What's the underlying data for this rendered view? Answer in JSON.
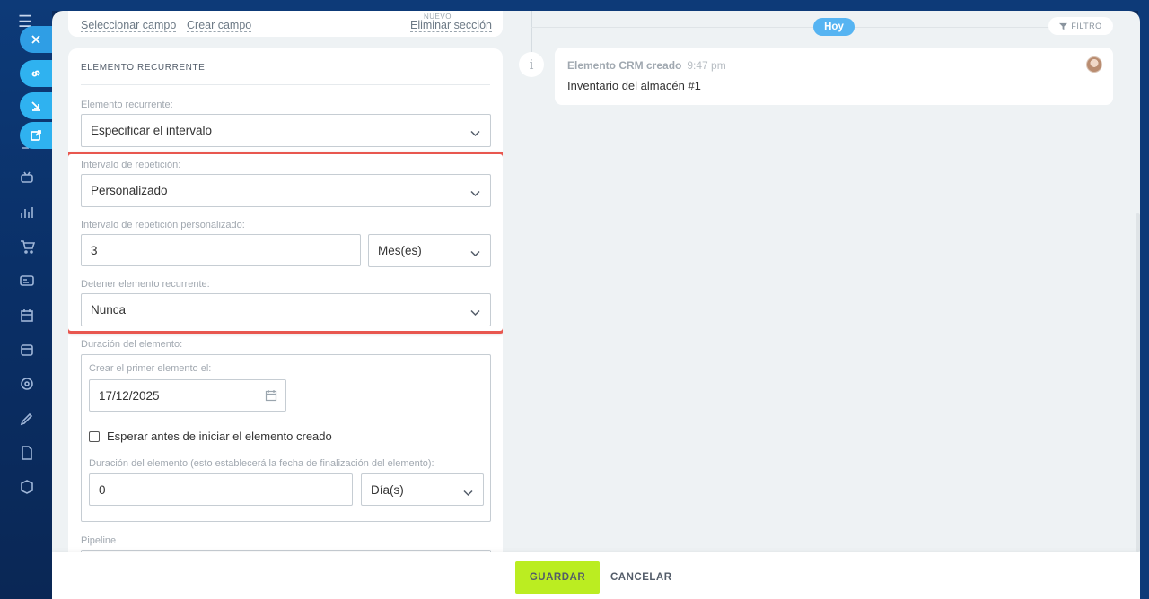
{
  "top_card": {
    "select_field": "Seleccionar campo",
    "create_field": "Crear campo",
    "new_badge": "NUEVO",
    "delete_section": "Eliminar sección"
  },
  "recurring": {
    "section_title": "ELEMENTO RECURRENTE",
    "recurring_label": "Elemento recurrente:",
    "recurring_value": "Especificar el intervalo",
    "interval_label": "Intervalo de repetición:",
    "interval_value": "Personalizado",
    "custom_label": "Intervalo de repetición personalizado:",
    "custom_number": "3",
    "custom_unit": "Mes(es)",
    "stop_label": "Detener elemento recurrente:",
    "stop_value": "Nunca",
    "duration_label": "Duración del elemento:",
    "first_label": "Crear el primer elemento el:",
    "first_date": "17/12/2025",
    "wait_label": "Esperar antes de iniciar el elemento creado",
    "duration_detail_label": "Duración del elemento (esto establecerá la fecha de finalización del elemento):",
    "duration_number": "0",
    "duration_unit": "Día(s)",
    "pipeline_label": "Pipeline"
  },
  "timeline": {
    "today": "Hoy",
    "filter": "FILTRO",
    "event_title": "Elemento CRM creado",
    "event_time": "9:47 pm",
    "event_body": "Inventario del almacén #1"
  },
  "footer": {
    "save": "GUARDAR",
    "cancel": "CANCELAR"
  },
  "colors": {
    "save_button": "#bbed21",
    "highlight_border": "#e8574f",
    "today_pill": "#56b4f2",
    "side_buttons": "#2fb2f0"
  },
  "icons": [
    "menu-icon",
    "close-icon",
    "link-icon",
    "download-icon",
    "external-link-icon",
    "chevron-down-icon",
    "calendar-icon",
    "filter-icon",
    "info-icon"
  ]
}
